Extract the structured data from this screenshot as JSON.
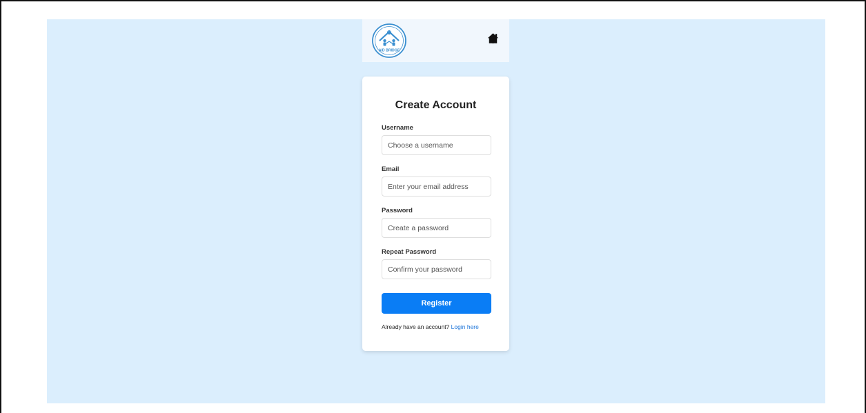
{
  "header": {
    "logo_text": "AID BRIDGE",
    "logo_color": "#3a8fd0",
    "home_icon": "home-icon"
  },
  "form": {
    "title": "Create Account",
    "fields": [
      {
        "label": "Username",
        "placeholder": "Choose a username",
        "value": ""
      },
      {
        "label": "Email",
        "placeholder": "Enter your email address",
        "value": ""
      },
      {
        "label": "Password",
        "placeholder": "Create a password",
        "value": ""
      },
      {
        "label": "Repeat Password",
        "placeholder": "Confirm your password",
        "value": ""
      }
    ],
    "submit_label": "Register",
    "login_prompt": "Already have an account?",
    "login_link": "Login here"
  },
  "colors": {
    "background": "#dbeefd",
    "primary_button": "#0a7df5",
    "link": "#1a73d9"
  }
}
